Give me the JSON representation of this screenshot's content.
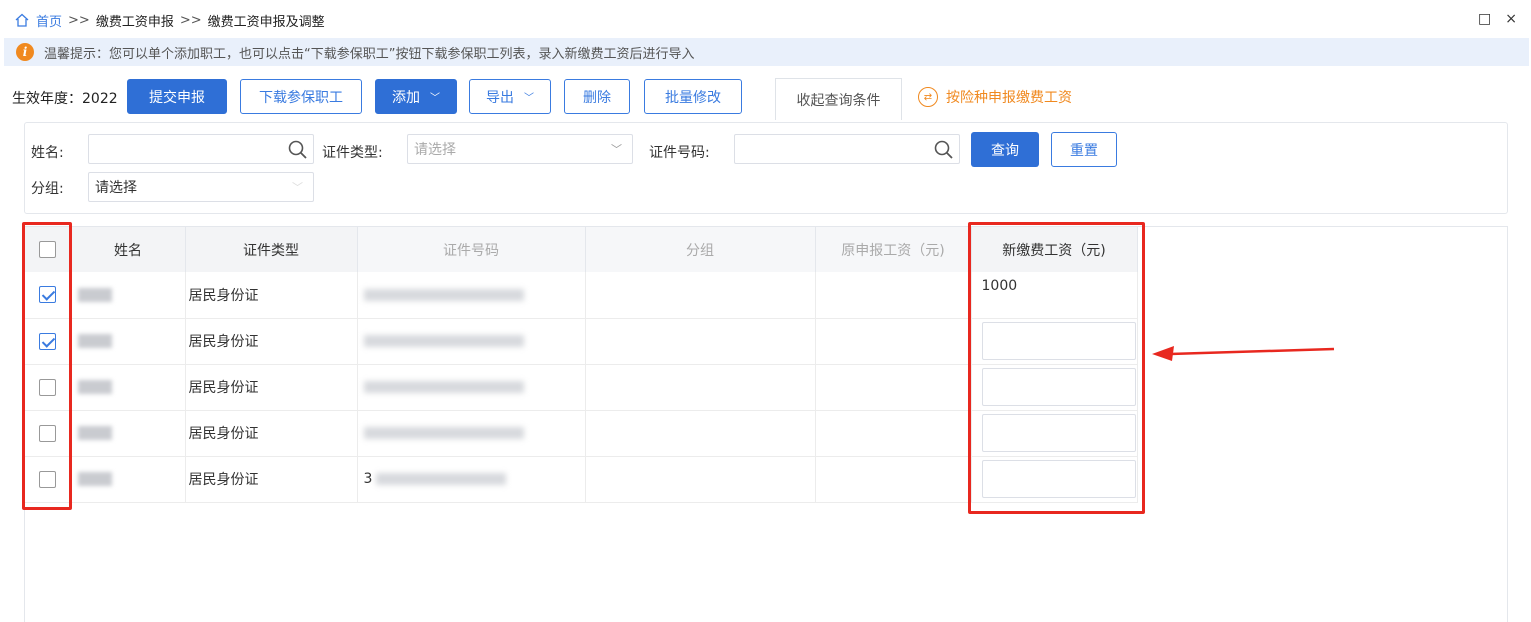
{
  "breadcrumb": {
    "home": "首页",
    "sep": ">>",
    "level1": "缴费工资申报",
    "level2": "缴费工资申报及调整"
  },
  "window_controls": {
    "maximize": "□",
    "close": "×"
  },
  "notice": {
    "icon_letter": "i",
    "text": "温馨提示：您可以单个添加职工，也可以点击“下载参保职工”按钮下载参保职工列表，录入新缴费工资后进行导入"
  },
  "toolbar": {
    "year_label": "生效年度：2022",
    "submit": "提交申报",
    "download": "下载参保职工",
    "add": "添加",
    "export": "导出",
    "delete": "删除",
    "batch_edit": "批量修改",
    "collapse": "收起查询条件",
    "by_insurance": "按险种申报缴费工资"
  },
  "filters": {
    "name_label": "姓名:",
    "cert_type_label": "证件类型:",
    "cert_type_placeholder": "请选择",
    "cert_no_label": "证件号码:",
    "group_label": "分组:",
    "group_value": "请选择",
    "query": "查询",
    "reset": "重置"
  },
  "table": {
    "headers": [
      "姓名",
      "证件类型",
      "证件号码",
      "分组",
      "原申报工资（元)",
      "新缴费工资（元)"
    ],
    "rows": [
      {
        "checked": true,
        "name_visible": "…斌",
        "cert_type": "居民身份证",
        "new_salary": "1000"
      },
      {
        "checked": true,
        "name_visible": "蒋…",
        "cert_type": "居民身份证",
        "new_salary": ""
      },
      {
        "checked": false,
        "name_visible": "任…斌",
        "cert_type": "居民身份证",
        "new_salary": ""
      },
      {
        "checked": false,
        "name_visible": "…",
        "cert_type": "居民身份证",
        "new_salary": ""
      },
      {
        "checked": false,
        "name_visible": "…解",
        "cert_type": "居民身份证",
        "id_prefix": "3",
        "new_salary": ""
      }
    ]
  },
  "colors": {
    "primary": "#2f6fd6",
    "accent_orange": "#f0891f",
    "highlight_red": "#e8281f"
  }
}
